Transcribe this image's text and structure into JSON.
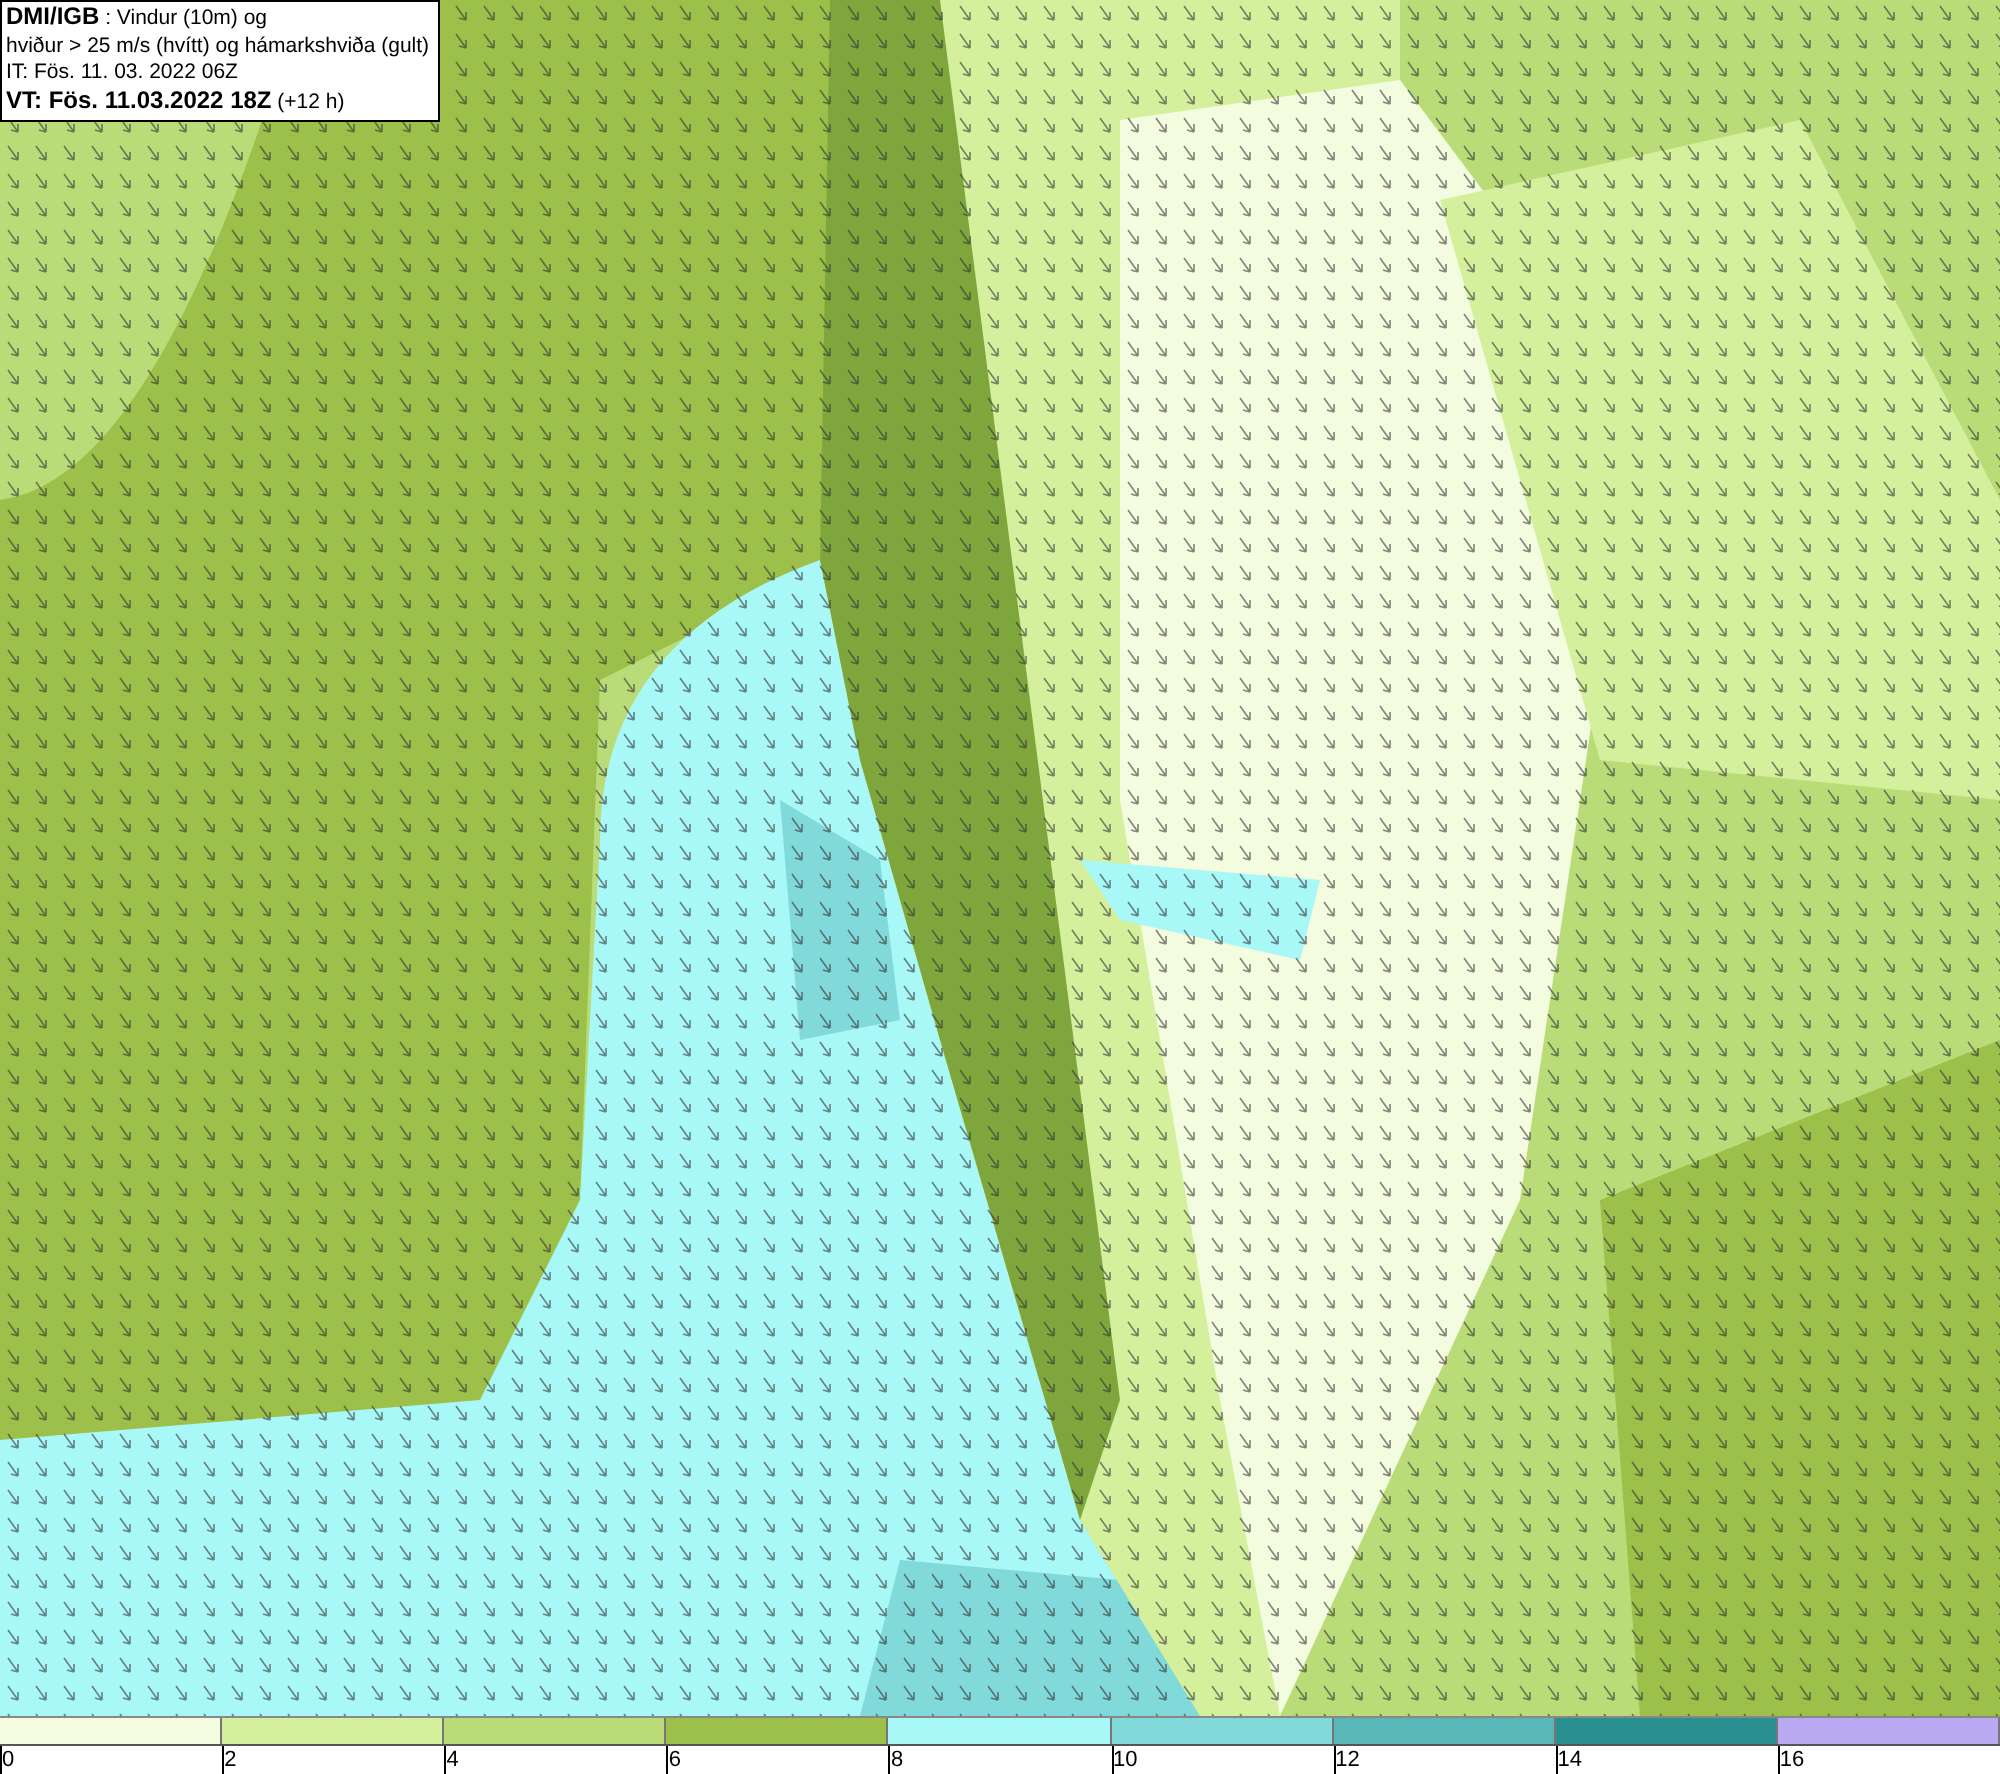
{
  "header": {
    "source": "DMI/IGB",
    "description": " : Vindur (10m) og",
    "line2": "hviður > 25 m/s (hvítt) og hámarkshviða (gult)",
    "issue_time": "IT: Fös. 11. 03. 2022 06Z",
    "valid_label": "VT: Fös. 11.03.2022 18Z",
    "valid_offset": " (+12 h)"
  },
  "legend": [
    {
      "label": "0",
      "color": "#f4fce0"
    },
    {
      "label": "2",
      "color": "#d5f09c"
    },
    {
      "label": "4",
      "color": "#b9dc78"
    },
    {
      "label": "6",
      "color": "#9cc04a"
    },
    {
      "label": "8",
      "color": "#a8f8f8"
    },
    {
      "label": "10",
      "color": "#82d9d9"
    },
    {
      "label": "12",
      "color": "#58b8b8"
    },
    {
      "label": "14",
      "color": "#2a9090"
    },
    {
      "label": "16",
      "color": "#b9a8f2"
    }
  ]
}
